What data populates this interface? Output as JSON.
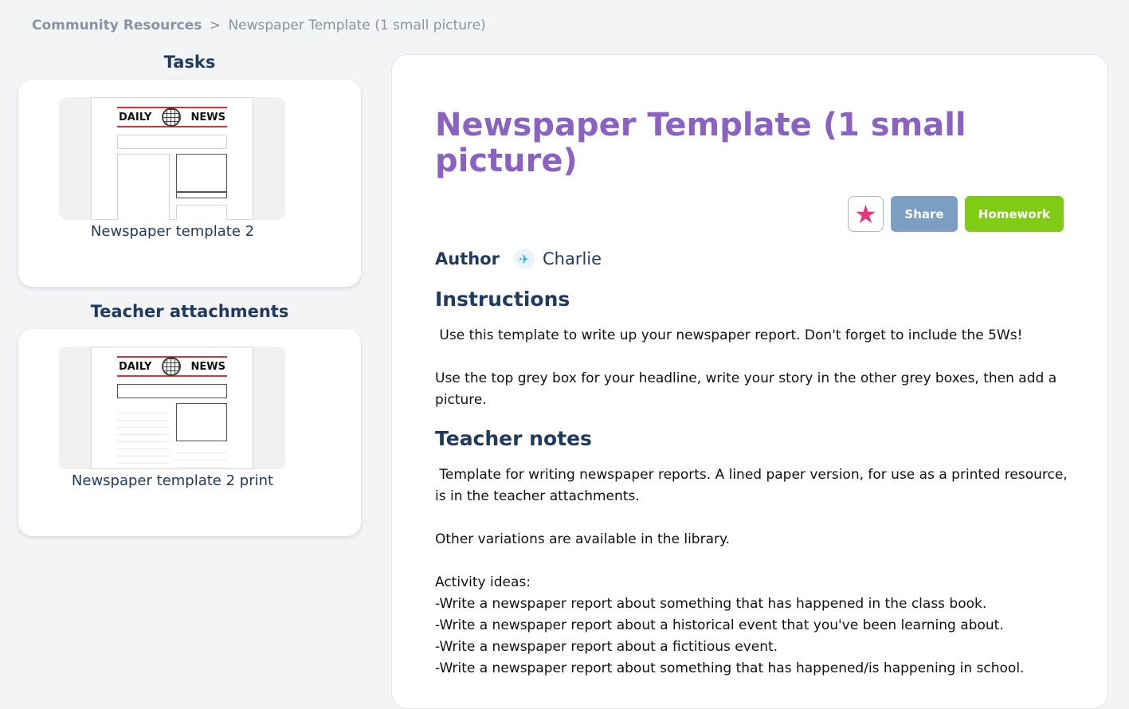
{
  "breadcrumb": {
    "root": "Community Resources",
    "separator": ">",
    "current": "Newspaper Template (1 small picture)"
  },
  "sidebar": {
    "tasks_heading": "Tasks",
    "tasks_item": {
      "title": "Newspaper template 2",
      "thumb_left": "DAILY",
      "thumb_right": "NEWS"
    },
    "attachments_heading": "Teacher attachments",
    "attachment_item": {
      "title": "Newspaper template 2 print",
      "thumb_left": "DAILY",
      "thumb_right": "NEWS"
    }
  },
  "main": {
    "title": "Newspaper Template (1 small picture)",
    "actions": {
      "favorite_icon": "star-icon",
      "share_label": "Share",
      "homework_label": "Homework"
    },
    "author_label": "Author",
    "author_name": "Charlie",
    "instructions_heading": "Instructions",
    "instructions_p1": " Use this template to write up your newspaper report. Don't forget to include the 5Ws!",
    "instructions_p2": "Use the top grey box for your headline, write your story in the other grey boxes, then add a picture.",
    "teacher_notes_heading": "Teacher notes",
    "notes_p1": " Template for writing newspaper reports. A lined paper version, for use as a printed resource, is in the teacher attachments.",
    "notes_p2": "Other variations are available in the library.",
    "notes_p3": "Activity ideas:\n-Write a newspaper report about something that has happened in the class book.\n-Write a newspaper report about a historical event that you've been learning about.\n-Write a newspaper report about a fictitious event.\n-Write a newspaper report about something that has happened/is happening in school."
  },
  "colors": {
    "title": "#8a63c2",
    "share": "#7b9ec2",
    "homework": "#80cc14",
    "star": "#e8387d"
  }
}
